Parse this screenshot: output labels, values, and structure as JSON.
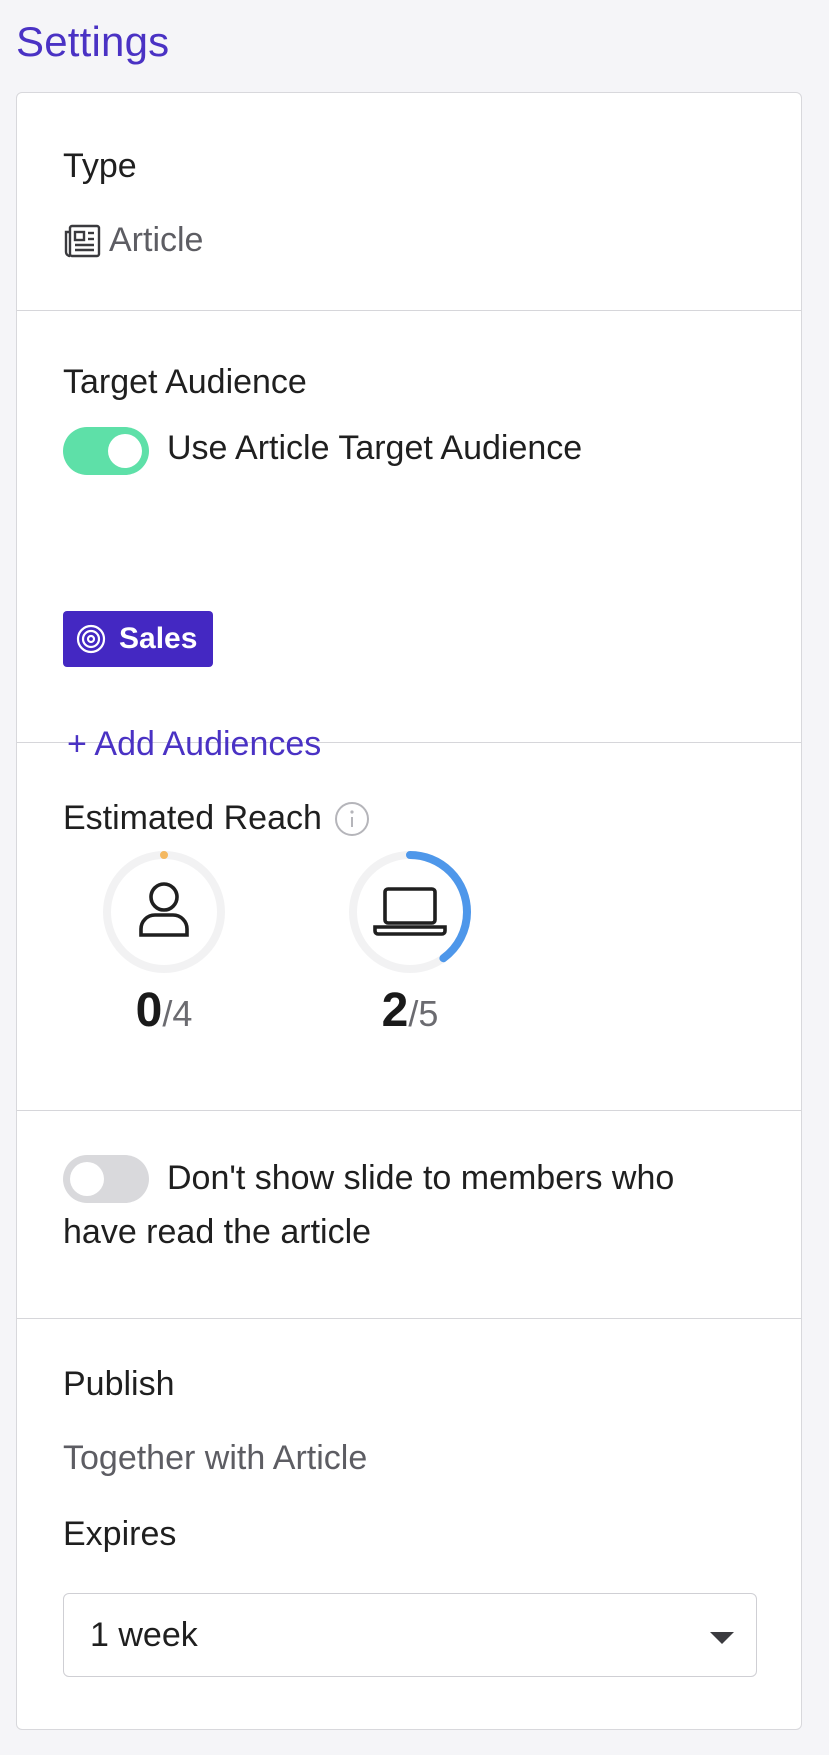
{
  "page": {
    "title": "Settings"
  },
  "type_section": {
    "label": "Type",
    "value": "Article",
    "icon": "newspaper-icon"
  },
  "audience_section": {
    "label": "Target Audience",
    "toggle": {
      "label": "Use Article Target Audience",
      "on": true,
      "color": "#5ee0a8"
    },
    "chips": [
      {
        "label": "Sales",
        "icon": "target-icon",
        "color": "#4428c2"
      }
    ],
    "add_link": "+ Add Audiences"
  },
  "reach_section": {
    "label": "Estimated Reach",
    "info_icon": "info-icon",
    "gauges": [
      {
        "icon": "user-icon",
        "count": "0",
        "total": "/4",
        "value": 0,
        "max": 4,
        "color": "#f4b860"
      },
      {
        "icon": "laptop-icon",
        "count": "2",
        "total": "/5",
        "value": 2,
        "max": 5,
        "color": "#4e97ea"
      }
    ]
  },
  "read_toggle_section": {
    "toggle": {
      "on": false,
      "color": "#d9d9dc"
    },
    "label_line1": "Don't show slide to members who",
    "label_line2": "have read the article"
  },
  "publish_section": {
    "label": "Publish",
    "value": "Together with Article",
    "expires_label": "Expires",
    "expires_value": "1 week"
  }
}
